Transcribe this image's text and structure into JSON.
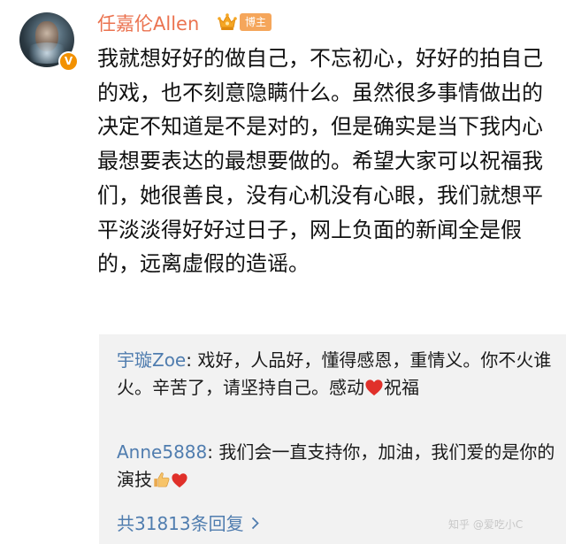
{
  "post": {
    "username": "任嘉伦Allen",
    "avatar_verified_badge": "V",
    "level_tag": "博主",
    "text": "我就想好好的做自己，不忘初心，好好的拍自己的戏，也不刻意隐瞒什么。虽然很多事情做出的决定不知道是不是对的，但是确实是当下我内心最想要表达的最想要做的。希望大家可以祝福我们，她很善良，没有心机没有心眼，我们就想平平淡淡得好好过日子，网上负面的新闻全是假的，远离虚假的造谣。"
  },
  "replies": [
    {
      "author": "宇璇Zoe",
      "text_before_emoji": "戏好，人品好，懂得感恩，重情义。你不火谁火。辛苦了，请坚持自己。感动",
      "emoji": "heart-icon",
      "text_after_emoji": "祝福"
    },
    {
      "author": "Anne5888",
      "text": "我们会一直支持你，加油，我们爱的是你的演技",
      "emojis": [
        "thumbs-up-icon",
        "heart-icon"
      ]
    }
  ],
  "footer": {
    "total_replies_label": "共31813条回复",
    "watermark": "知乎 @爱吃小C"
  },
  "colors": {
    "username": "#eb7350",
    "link": "#507daf",
    "heart": "#e0302a",
    "crown": "#f5a623",
    "tag": "#f5a65b",
    "verified": "#f29100",
    "comments_bg": "#f2f2f2"
  }
}
